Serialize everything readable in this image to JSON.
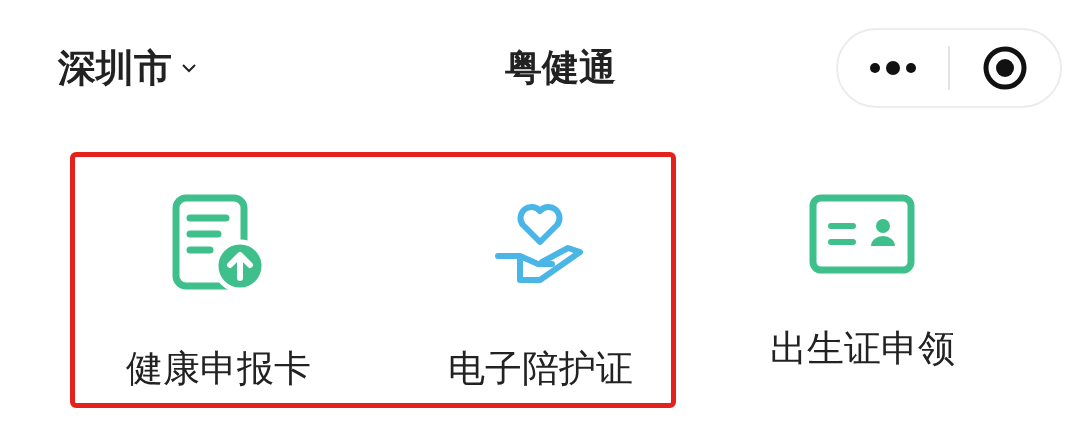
{
  "header": {
    "city": "深圳市",
    "title": "粤健通"
  },
  "services": [
    {
      "label": "健康申报卡",
      "kind": "declaration",
      "highlighted": true
    },
    {
      "label": "电子陪护证",
      "kind": "escort",
      "highlighted": true
    },
    {
      "label": "出生证申领",
      "kind": "birth",
      "highlighted": false
    }
  ]
}
